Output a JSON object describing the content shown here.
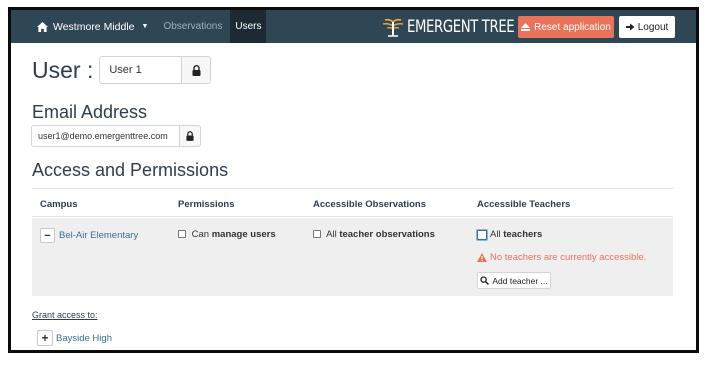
{
  "navbar": {
    "school": "Westmore Middle",
    "links": [
      "Observations",
      "Users"
    ],
    "logo_text": "EMERGENT TREE",
    "reset_label": "Reset application",
    "logout_label": "Logout",
    "bg_color": "#2f4654",
    "reset_color": "#e8735a"
  },
  "user": {
    "heading": "User :",
    "username": "User 1"
  },
  "email": {
    "heading": "Email Address",
    "value": "user1@demo.emergenttree.com"
  },
  "access": {
    "heading": "Access and Permissions",
    "columns": [
      "Campus",
      "Permissions",
      "Accessible Observations",
      "Accessible Teachers"
    ],
    "row": {
      "campus": "Bel-Air Elementary",
      "perm_prefix": "Can",
      "perm_bold": "manage users",
      "obs_prefix": "All",
      "obs_bold": "teacher observations",
      "teach_prefix": "All",
      "teach_bold": "teachers",
      "warning": "No teachers are currently accessible.",
      "add_teacher": "Add teacher ..."
    }
  },
  "grant": {
    "label": "Grant access to:",
    "campuses": [
      "Bayside High"
    ]
  },
  "icons": {
    "home": "home-icon",
    "lock": "lock-icon",
    "warning": "warning-icon",
    "search": "search-icon",
    "logout": "logout-icon",
    "eject": "eject-icon"
  }
}
